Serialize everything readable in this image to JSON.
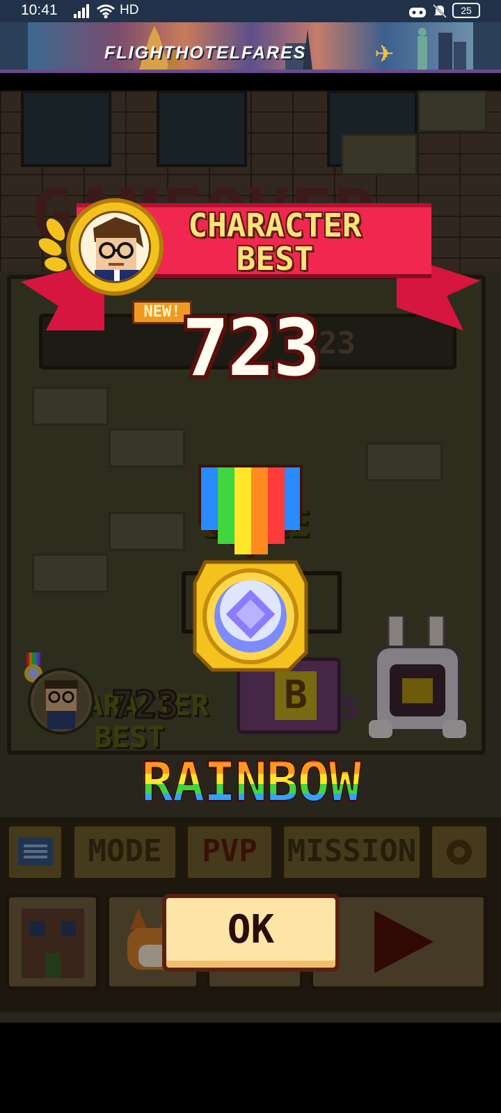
{
  "status_bar": {
    "time": "10:41",
    "network": "HD",
    "battery": "25"
  },
  "ad": {
    "brand_text": "FLIGHTHOTELFARES"
  },
  "background": {
    "title_text": "GAMEOVER",
    "score_label": "SCORE",
    "character_best_label": "CHARACTER BEST",
    "bonus_label": "US",
    "best_value": "723",
    "b_button_label": "B",
    "menu": {
      "mode_label": "MODE",
      "pvp_label": "PVP",
      "mission_label": "MISSION"
    }
  },
  "popup": {
    "banner_line1": "CHARACTER",
    "banner_line2": "BEST",
    "new_badge": "NEW!",
    "score": "723",
    "medal_name": "RAINBOW",
    "ok_label": "OK"
  },
  "colors": {
    "ribbon": "#f0284f",
    "banner_text": "#fde37a",
    "gold": "#f4c21c",
    "ok_bg": "#fde5a8"
  }
}
